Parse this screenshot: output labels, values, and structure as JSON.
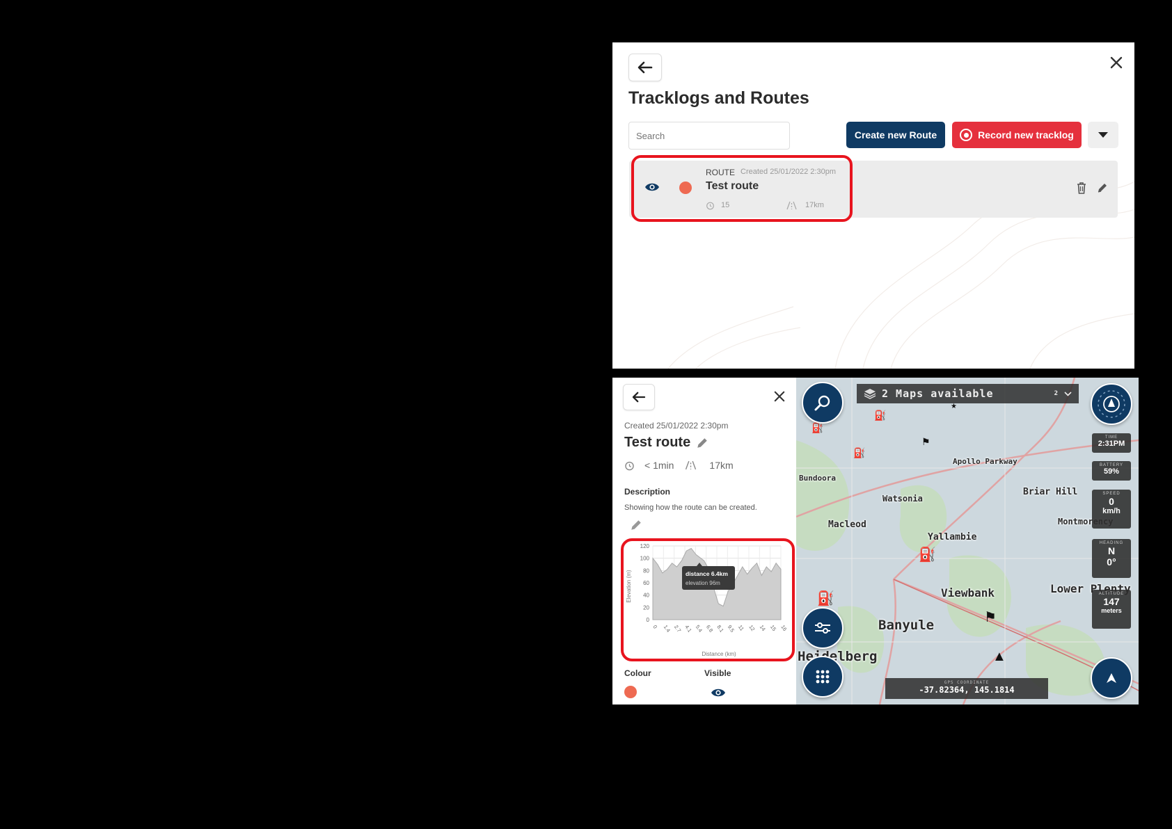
{
  "list_panel": {
    "title": "Tracklogs and Routes",
    "search_placeholder": "Search",
    "create_route_label": "Create new Route",
    "record_tracklog_label": "Record new tracklog",
    "route": {
      "type": "ROUTE",
      "created": "Created 25/01/2022 2:30pm",
      "name": "Test route",
      "duration": "15",
      "distance": "17km",
      "color": "#ee6a52"
    }
  },
  "detail_panel": {
    "created": "Created 25/01/2022 2:30pm",
    "name": "Test route",
    "duration": "< 1min",
    "distance": "17km",
    "description_heading": "Description",
    "description": "Showing how the route can be created.",
    "colour_heading": "Colour",
    "visible_heading": "Visible",
    "colour": "#ee6a52"
  },
  "chart_data": {
    "type": "area",
    "xlabel": "Distance (km)",
    "ylabel": "Elevation (m)",
    "ylim": [
      0,
      120
    ],
    "yticks": [
      0,
      20,
      40,
      60,
      80,
      100,
      120
    ],
    "xticks": [
      "0",
      "1.4",
      "2.7",
      "4.1",
      "5.4",
      "6.8",
      "8.1",
      "9.5",
      "11",
      "12",
      "14",
      "15",
      "16"
    ],
    "x": [
      0,
      0.6,
      1.2,
      1.8,
      2.4,
      3,
      3.6,
      4.2,
      4.8,
      5.4,
      6,
      6.4,
      7,
      7.6,
      8.2,
      8.8,
      9.4,
      10,
      10.6,
      11.2,
      11.8,
      12.4,
      13,
      13.6,
      14.2,
      14.8,
      15.4,
      16
    ],
    "y": [
      100,
      90,
      76,
      82,
      92,
      86,
      96,
      112,
      116,
      106,
      100,
      96,
      82,
      52,
      26,
      22,
      46,
      58,
      72,
      86,
      74,
      84,
      92,
      72,
      86,
      78,
      92,
      82
    ],
    "tooltip": {
      "distance": "distance 6.4km",
      "elevation": "elevation 96m"
    }
  },
  "map": {
    "maps_available": "2 Maps available",
    "map_count_badge": "2",
    "time_label": "TIME",
    "time_value": "2:31PM",
    "battery_label": "BATTERY",
    "battery_value": "59%",
    "speed_label": "SPEED",
    "speed_value": "0",
    "speed_unit": "km/h",
    "heading_label": "HEADING",
    "heading_dir": "N",
    "heading_deg": "0°",
    "altitude_label": "ALTITUDE",
    "altitude_value": "147",
    "altitude_unit": "meters",
    "coord_label": "GPS COORDINATE",
    "coord_value": "-37.82364, 145.1814",
    "places": [
      "Bundoora",
      "Apollo Parkway",
      "Watsonia",
      "Briar Hill",
      "Macleod",
      "Yallambie",
      "Montmorency",
      "Viewbank",
      "Lower Plenty",
      "Banyule",
      "Heidelberg"
    ]
  }
}
